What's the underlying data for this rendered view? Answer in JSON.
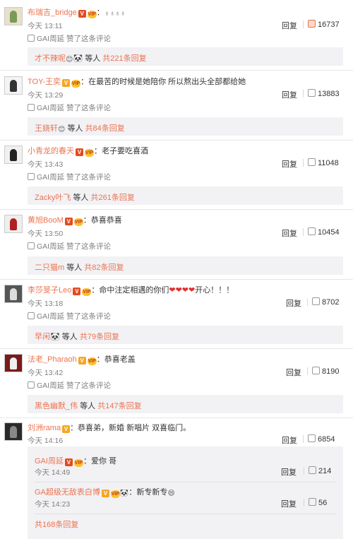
{
  "liked_label": "赞了这条评论",
  "reply_label": "回复",
  "comments": [
    {
      "user": "布瑞吉_bridge",
      "badges": [
        "red-v",
        "vip"
      ],
      "text": "：",
      "emoji_text": "♁♁♁♁",
      "time": "今天 13:11",
      "liked_by": "GAI周延",
      "likes": "16737",
      "sub": {
        "names": "才不辣呢",
        "extra": "🐼",
        "mid": " 等人 ",
        "count": "共221条回复"
      }
    },
    {
      "user": "TOY-王奕",
      "badges": [
        "gold-v",
        "vip"
      ],
      "text": "：在最苦的时候是她陪你 所以熬出头全部都给她",
      "time": "今天 13:29",
      "liked_by": "GAI周延",
      "likes": "13883",
      "sub": {
        "names": "王娆轩",
        "extra": "",
        "mid": " 等人 ",
        "count": "共84条回复"
      }
    },
    {
      "user": "小青龙的春天",
      "badges": [
        "red-v",
        "vip"
      ],
      "text": "：老子要吃喜酒",
      "time": "今天 13:43",
      "liked_by": "GAI周延",
      "likes": "11048",
      "sub": {
        "names": "Zacky叶飞",
        "extra": "",
        "mid": " 等人 ",
        "count": "共261条回复"
      }
    },
    {
      "user": "黄旭BooM",
      "badges": [
        "red-v",
        "vip"
      ],
      "text": "：恭喜恭喜",
      "time": "今天 13:50",
      "liked_by": "GAI周延",
      "likes": "10454",
      "sub": {
        "names": "二只猫m",
        "extra": "",
        "mid": " 等人 ",
        "count": "共82条回复"
      }
    },
    {
      "user": "李莎旻子Leo",
      "badges": [
        "red-v",
        "vip"
      ],
      "text": "：命中注定相遇的你们",
      "hearts": "❤❤❤❤",
      "text_after": "开心！！！",
      "time": "今天 13:18",
      "liked_by": "GAI周延",
      "likes": "8702",
      "sub": {
        "names": "早闲",
        "extra": "🐼",
        "mid": " 等人 ",
        "count": "共79条回复"
      }
    },
    {
      "user": "法老_Pharaoh",
      "badges": [
        "gold-v",
        "vip"
      ],
      "text": "：恭喜老盖",
      "time": "今天 13:42",
      "liked_by": "GAI周延",
      "likes": "8190",
      "sub": {
        "names": "黑色幽默_伟",
        "extra": "",
        "mid": " 等人 ",
        "count": "共147条回复"
      }
    },
    {
      "user": "刘洲rama",
      "badges": [
        "gold-v"
      ],
      "text": "：恭喜弟，新婚 新唱片 双喜临门。",
      "time": "今天 14:16",
      "likes": "6854"
    }
  ],
  "nested": [
    {
      "user": "GAI周延",
      "text": "：爱你 哥",
      "time": "今天 14:49",
      "likes": "214"
    },
    {
      "user": "GA超级无敌表白博",
      "text": "：新专新专",
      "time": "今天 14:23",
      "likes": "56"
    }
  ],
  "nested_total": "共168条回复",
  "colors": {
    "accent": "#eb7350",
    "muted": "#808080",
    "sub_bg": "#f2f2f5"
  }
}
